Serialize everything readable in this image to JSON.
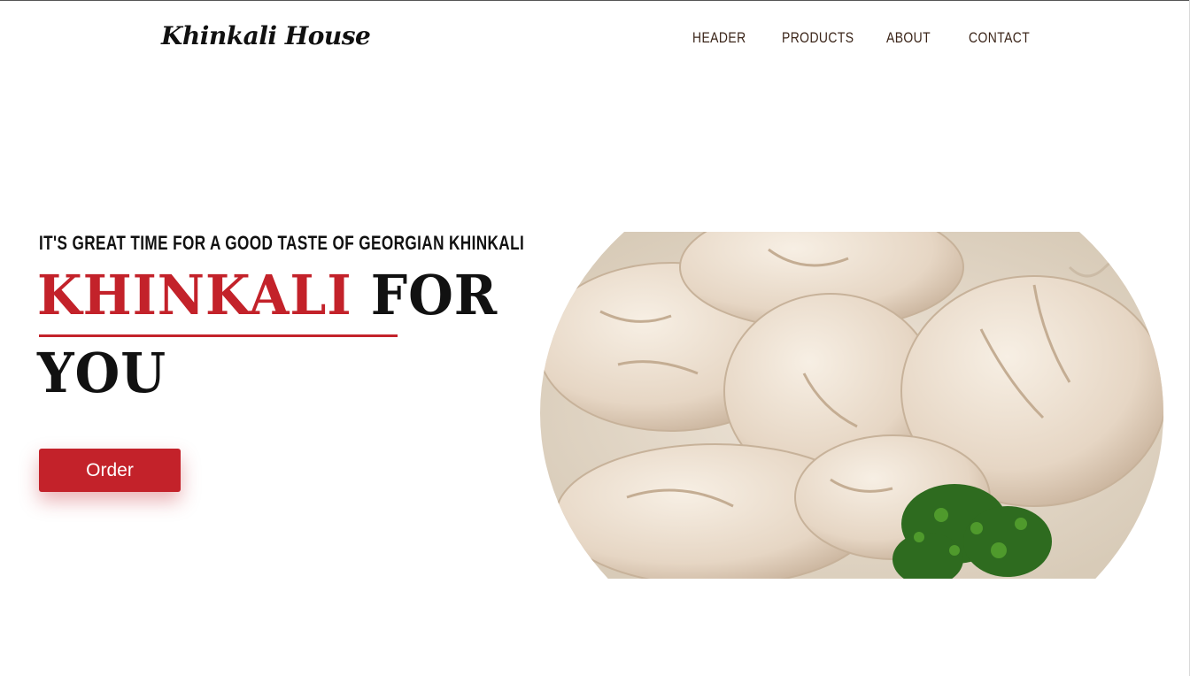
{
  "brand": {
    "logo_text": "Khinkali House"
  },
  "nav": {
    "items": [
      "HEADER",
      "PRODUCTS",
      "ABOUT",
      "CONTACT"
    ]
  },
  "hero": {
    "tagline": "IT'S GREAT TIME FOR A GOOD TASTE OF GEORGIAN KHINKALI",
    "headline_accent": "KHINKALI",
    "headline_rest": "FOR",
    "headline_line2": "YOU",
    "cta_label": "Order",
    "image_subject": "plate of khinkali dumplings with chopped herbs"
  },
  "colors": {
    "accent": "#c3222a",
    "text": "#111111",
    "nav_text": "#3a2418",
    "background": "#ffffff"
  }
}
